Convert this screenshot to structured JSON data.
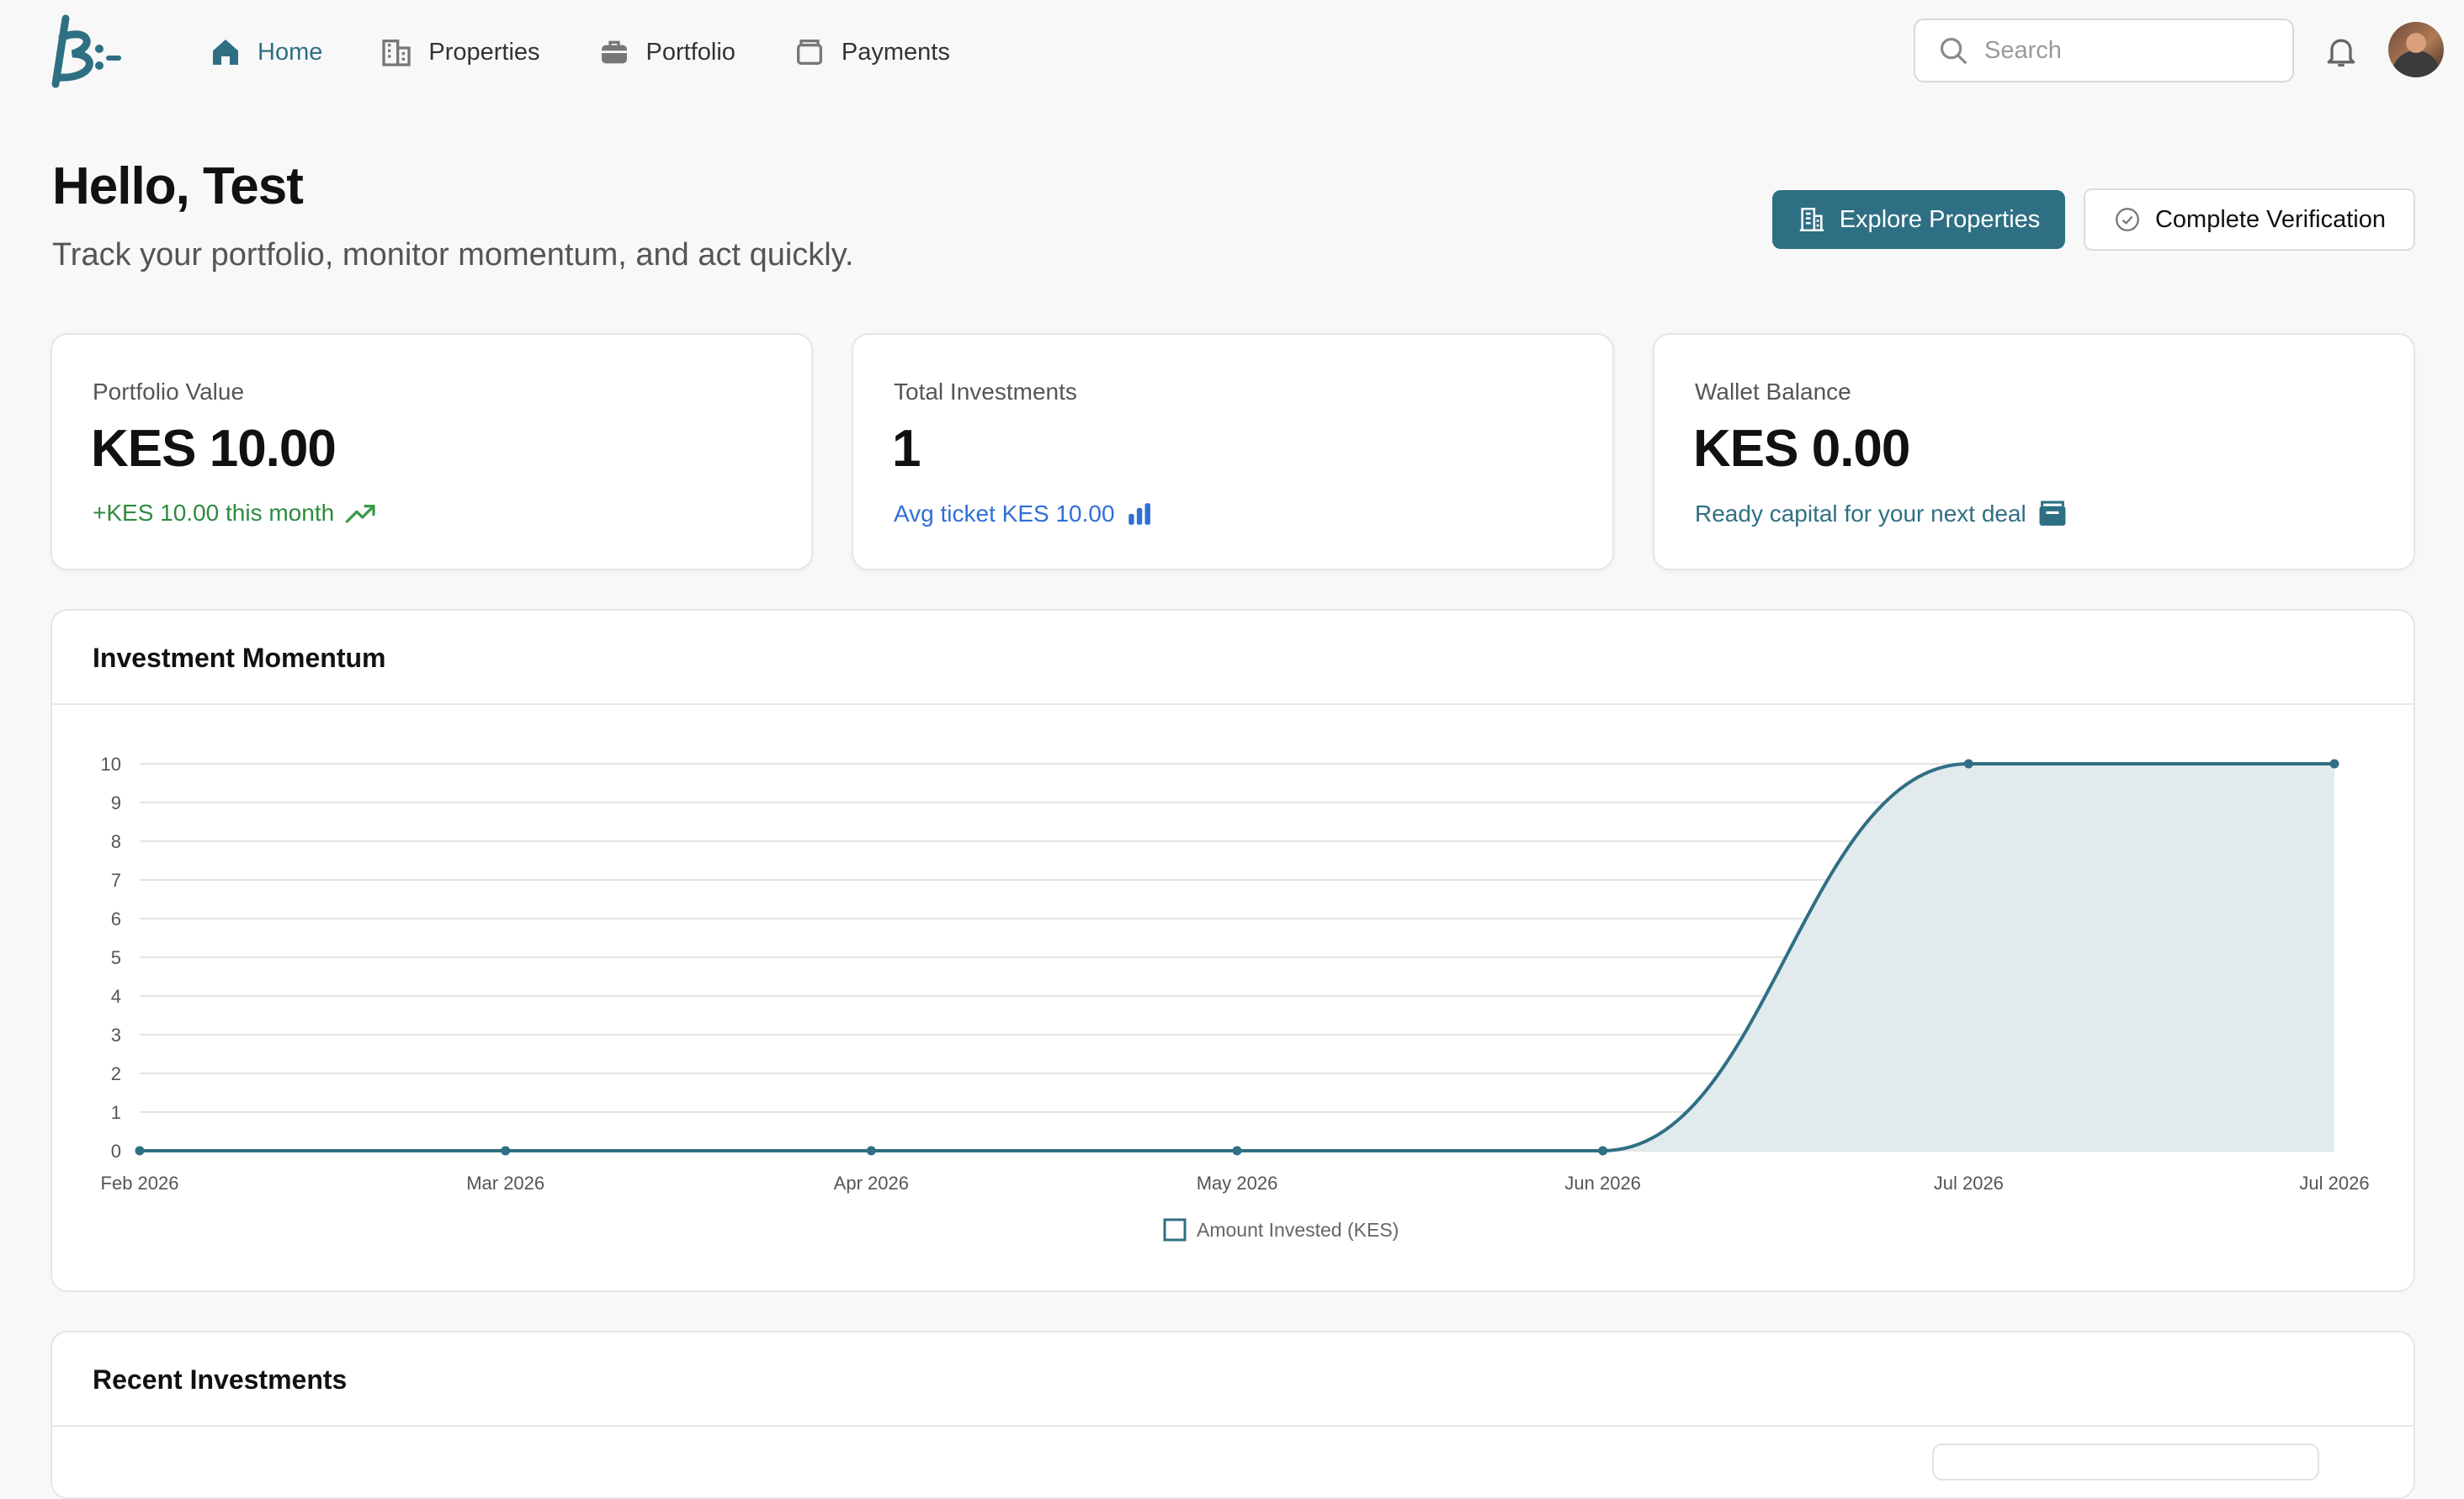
{
  "nav": {
    "items": [
      {
        "label": "Home",
        "icon": "home-icon",
        "active": true
      },
      {
        "label": "Properties",
        "icon": "building-icon",
        "active": false
      },
      {
        "label": "Portfolio",
        "icon": "briefcase-icon",
        "active": false
      },
      {
        "label": "Payments",
        "icon": "wallet-icon",
        "active": false
      }
    ],
    "search_placeholder": "Search"
  },
  "header": {
    "greeting": "Hello, Test",
    "subtitle": "Track your portfolio, monitor momentum, and act quickly.",
    "primary_button": "Explore Properties",
    "secondary_button": "Complete Verification"
  },
  "stats": [
    {
      "label": "Portfolio Value",
      "value": "KES 10.00",
      "note": "+KES 10.00 this month",
      "note_color": "#2e8b3e",
      "icon": "trending-up-icon"
    },
    {
      "label": "Total Investments",
      "value": "1",
      "note": "Avg ticket KES 10.00",
      "note_color": "#2f6fd6",
      "icon": "bar-chart-icon"
    },
    {
      "label": "Wallet Balance",
      "value": "KES 0.00",
      "note": "Ready capital for your next deal",
      "note_color": "#2f6f84",
      "icon": "wallet-icon"
    }
  ],
  "momentum": {
    "title": "Investment Momentum"
  },
  "recent": {
    "title": "Recent Investments"
  },
  "colors": {
    "accent": "#2f6f84",
    "area_fill": "#e1eaed",
    "positive": "#2e8b3e",
    "link": "#2f6fd6"
  },
  "chart_data": {
    "type": "area",
    "x": [
      "Feb 2026",
      "Mar 2026",
      "Apr 2026",
      "May 2026",
      "Jun 2026",
      "Jul 2026",
      "Jul 2026"
    ],
    "series": [
      {
        "name": "Amount Invested (KES)",
        "values": [
          0,
          0,
          0,
          0,
          0,
          10,
          10
        ]
      }
    ],
    "ylim": [
      0,
      10
    ],
    "yticks": [
      0,
      1,
      2,
      3,
      4,
      5,
      6,
      7,
      8,
      9,
      10
    ],
    "grid": true,
    "legend": "bottom"
  }
}
